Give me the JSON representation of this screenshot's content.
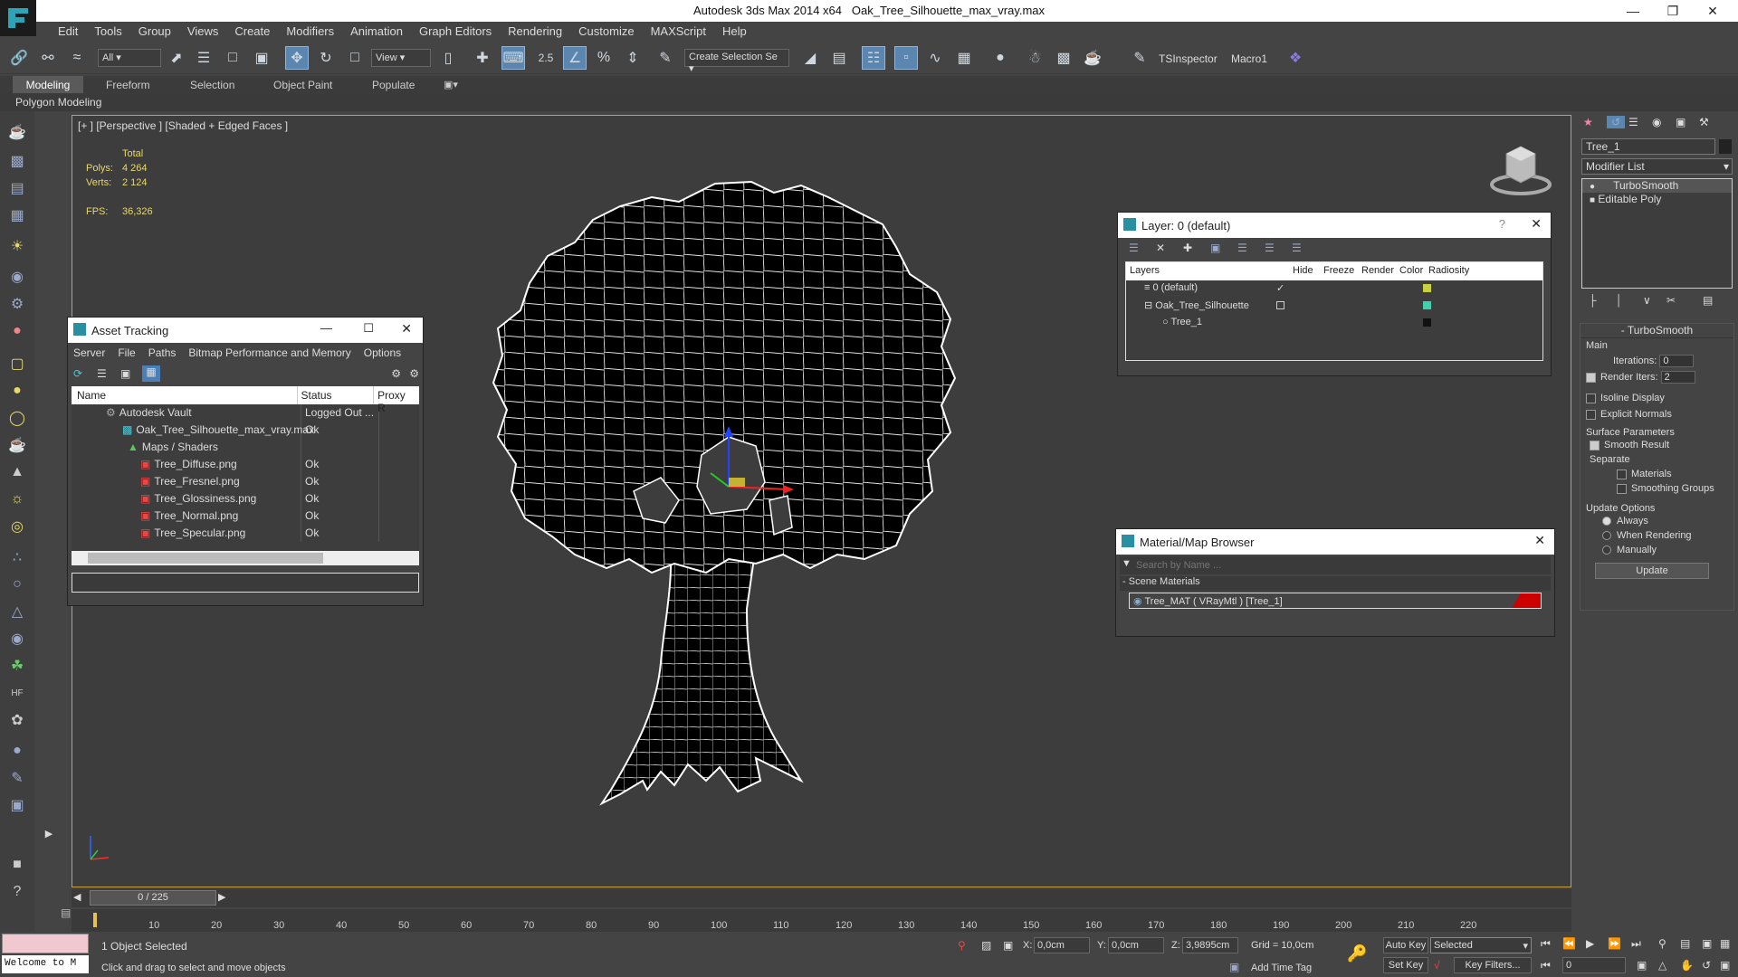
{
  "window": {
    "app_title": "Autodesk 3ds Max  2014 x64",
    "file_title": "Oak_Tree_Silhouette_max_vray.max"
  },
  "menu": [
    "Edit",
    "Tools",
    "Group",
    "Views",
    "Create",
    "Modifiers",
    "Animation",
    "Graph Editors",
    "Rendering",
    "Customize",
    "MAXScript",
    "Help"
  ],
  "toolbar": {
    "selection_filter": "All",
    "ref_coord": "View",
    "snap_value": "2.5",
    "named_sel": "Create Selection Se",
    "ts_inspector": "TSInspector",
    "macro": "Macro1"
  },
  "ribbon": {
    "tabs": [
      "Modeling",
      "Freeform",
      "Selection",
      "Object Paint",
      "Populate"
    ],
    "polygon_modeling": "Polygon Modeling"
  },
  "viewport": {
    "label": "[+ ] [Perspective ] [Shaded + Edged Faces ]",
    "stats": {
      "total_label": "Total",
      "polys_label": "Polys:",
      "polys": "4 264",
      "verts_label": "Verts:",
      "verts": "2 124",
      "fps_label": "FPS:",
      "fps": "36,326"
    }
  },
  "asset_tracking": {
    "title": "Asset Tracking",
    "menu": [
      "Server",
      "File",
      "Paths",
      "Bitmap Performance and Memory",
      "Options"
    ],
    "columns": [
      "Name",
      "Status",
      "Proxy R"
    ],
    "rows": [
      {
        "name": "Autodesk Vault",
        "status": "Logged Out ..."
      },
      {
        "name": "Oak_Tree_Silhouette_max_vray.max",
        "status": "Ok"
      },
      {
        "name": "Maps / Shaders",
        "status": ""
      },
      {
        "name": "Tree_Diffuse.png",
        "status": "Ok"
      },
      {
        "name": "Tree_Fresnel.png",
        "status": "Ok"
      },
      {
        "name": "Tree_Glossiness.png",
        "status": "Ok"
      },
      {
        "name": "Tree_Normal.png",
        "status": "Ok"
      },
      {
        "name": "Tree_Specular.png",
        "status": "Ok"
      }
    ]
  },
  "layer_dialog": {
    "title": "Layer: 0 (default)",
    "columns": [
      "Layers",
      "Hide",
      "Freeze",
      "Render",
      "Color",
      "Radiosity"
    ],
    "rows": [
      {
        "name": "0 (default)",
        "color": "#c8d040"
      },
      {
        "name": "Oak_Tree_Silhouette",
        "color": "#40d0b0"
      },
      {
        "name": "Tree_1",
        "color": "#111111"
      }
    ]
  },
  "material_browser": {
    "title": "Material/Map Browser",
    "search_placeholder": "Search by Name ...",
    "section": "Scene Materials",
    "item": "Tree_MAT ( VRayMtl ) [Tree_1]"
  },
  "command_panel": {
    "object_name": "Tree_1",
    "modifier_list": "Modifier List",
    "stack": [
      "TurboSmooth",
      "Editable Poly"
    ],
    "rollout_title": "TurboSmooth",
    "main_label": "Main",
    "iterations_label": "Iterations:",
    "iterations": "0",
    "render_iters_label": "Render Iters:",
    "render_iters": "2",
    "isoline": "Isoline Display",
    "explicit_normals": "Explicit Normals",
    "surface_params": "Surface Parameters",
    "smooth_result": "Smooth Result",
    "separate": "Separate",
    "materials": "Materials",
    "smoothing_groups": "Smoothing Groups",
    "update_options": "Update Options",
    "always": "Always",
    "when_rendering": "When Rendering",
    "manually": "Manually",
    "update_btn": "Update"
  },
  "timeline": {
    "frame": "0 / 225",
    "ticks": [
      "10",
      "20",
      "30",
      "40",
      "50",
      "60",
      "70",
      "80",
      "90",
      "100",
      "110",
      "120",
      "130",
      "140",
      "150",
      "160",
      "170",
      "180",
      "190",
      "200",
      "210",
      "220"
    ]
  },
  "status": {
    "welcome": "Welcome to M",
    "selected": "1 Object Selected",
    "prompt": "Click and drag to select and move objects",
    "x_label": "X:",
    "x": "0,0cm",
    "y_label": "Y:",
    "y": "0,0cm",
    "z_label": "Z:",
    "z": "3,9895cm",
    "grid": "Grid = 10,0cm",
    "auto_key": "Auto Key",
    "set_key": "Set Key",
    "key_mode": "Selected",
    "key_filters": "Key Filters...",
    "add_time_tag": "Add Time Tag",
    "frame_field": "0"
  }
}
